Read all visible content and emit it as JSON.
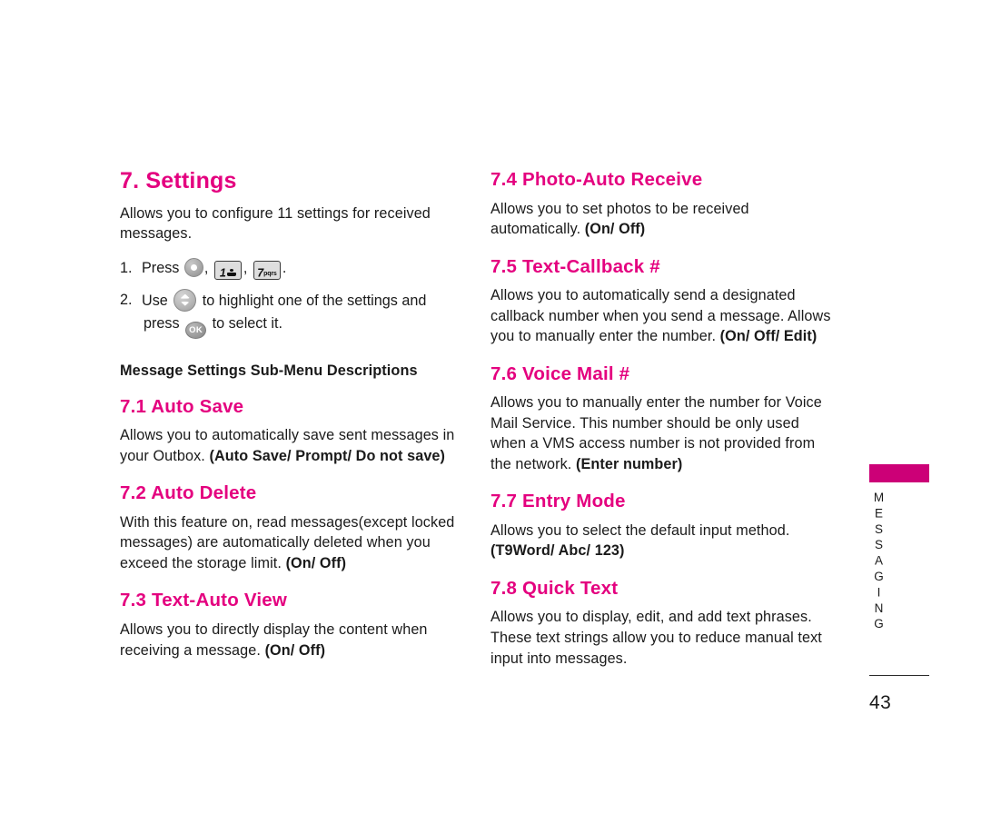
{
  "document": {
    "chapter_heading": "7. Settings",
    "intro": "Allows you to configure 11 settings for received messages.",
    "steps": [
      {
        "num": "1.",
        "lead": "Press",
        "keys": [
          {
            "type": "round-key",
            "label": ""
          },
          {
            "type": "keypad",
            "digit": "1",
            "sub": ""
          },
          {
            "type": "keypad",
            "digit": "7",
            "sub": "pqrs"
          }
        ],
        "trail": "."
      },
      {
        "num": "2.",
        "lead": "Use",
        "mid": "to highlight one of the settings and",
        "press_word": "press",
        "trail": "to select it."
      }
    ],
    "subhead": "Message Settings Sub-Menu Descriptions",
    "left_sections": [
      {
        "title": "7.1 Auto Save",
        "body": "Allows you to automatically save sent messages in your Outbox. ",
        "bold_tail": "(Auto Save/ Prompt/ Do not save)"
      },
      {
        "title": "7.2 Auto Delete",
        "body": "With this feature on, read messages(except locked messages) are automatically deleted when you exceed the storage limit. ",
        "bold_tail": "(On/ Off)"
      },
      {
        "title": "7.3 Text-Auto View",
        "body": "Allows you to directly display the content when receiving a message. ",
        "bold_tail": "(On/ Off)"
      }
    ],
    "right_sections": [
      {
        "title": "7.4 Photo-Auto Receive",
        "body": "Allows you to set photos to be received automatically. ",
        "bold_tail": "(On/ Off)"
      },
      {
        "title": "7.5 Text-Callback #",
        "body": "Allows you to automatically send a designated callback number when you send a message. Allows you to manually enter the number. ",
        "bold_tail": "(On/ Off/ Edit)"
      },
      {
        "title": "7.6 Voice Mail #",
        "body": "Allows you to manually enter the number for Voice Mail Service. This number should be only used when a VMS access number is not provided from the network. ",
        "bold_tail": "(Enter number)"
      },
      {
        "title": "7.7 Entry Mode",
        "body": "Allows you to select the default input method. ",
        "bold_tail": "(T9Word/ Abc/ 123)"
      },
      {
        "title": "7.8 Quick Text",
        "body": "Allows you to display, edit, and add text phrases. These text strings allow you to reduce manual text input into messages.",
        "bold_tail": ""
      }
    ],
    "sidebar": {
      "section_label": "MESSAGING",
      "page_number": "43"
    },
    "keys": {
      "ok_label": "OK",
      "key1_digit": "1",
      "key7_digit": "7",
      "key7_sub": "pqrs"
    },
    "colors": {
      "heading_magenta": "#e4007f",
      "tab_magenta": "#cc0077",
      "body_text": "#1a1a1a"
    }
  }
}
